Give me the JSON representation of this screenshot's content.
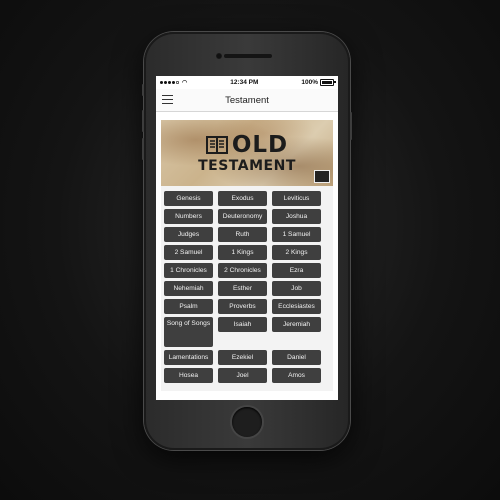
{
  "status": {
    "time": "12:34 PM",
    "battery": "100%",
    "battery_level": 1.0
  },
  "nav": {
    "title": "Testament",
    "menu_icon": "hamburger-icon"
  },
  "banner": {
    "line1": "OLD",
    "line2": "TESTAMENT",
    "icon": "book-icon"
  },
  "books": [
    {
      "label": "Genesis"
    },
    {
      "label": "Exodus"
    },
    {
      "label": "Leviticus"
    },
    {
      "label": "Numbers"
    },
    {
      "label": "Deuteronomy"
    },
    {
      "label": "Joshua"
    },
    {
      "label": "Judges"
    },
    {
      "label": "Ruth"
    },
    {
      "label": "1 Samuel"
    },
    {
      "label": "2 Samuel"
    },
    {
      "label": "1 Kings"
    },
    {
      "label": "2 Kings"
    },
    {
      "label": "1 Chronicles"
    },
    {
      "label": "2 Chronicles"
    },
    {
      "label": "Ezra"
    },
    {
      "label": "Nehemiah"
    },
    {
      "label": "Esther"
    },
    {
      "label": "Job"
    },
    {
      "label": "Psalm"
    },
    {
      "label": "Proverbs"
    },
    {
      "label": "Ecclesiastes"
    },
    {
      "label": "Song of Songs"
    },
    {
      "label": "Isaiah"
    },
    {
      "label": "Jeremiah"
    },
    {
      "label": "Lamentations"
    },
    {
      "label": "Ezekiel"
    },
    {
      "label": "Daniel"
    },
    {
      "label": "Hosea"
    },
    {
      "label": "Joel"
    },
    {
      "label": "Amos"
    }
  ],
  "colors": {
    "button_bg": "#3f3f3f",
    "button_text": "#f2f2f2",
    "grid_bg": "#f3f3f3"
  }
}
